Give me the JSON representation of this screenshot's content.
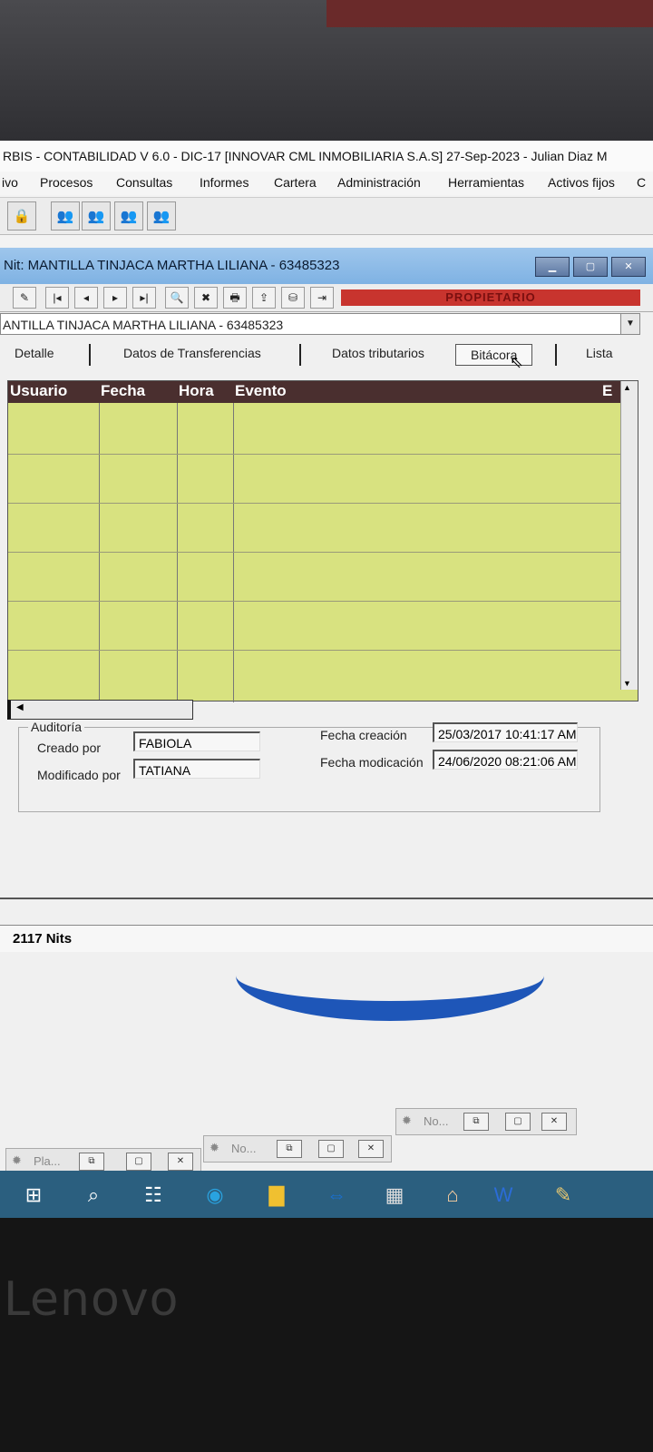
{
  "app": {
    "title": "RBIS - CONTABILIDAD V 6.0 - DIC-17 [INNOVAR CML INMOBILIARIA S.A.S] 27-Sep-2023 - Julian Diaz M",
    "menu": [
      "ivo",
      "Procesos",
      "Consultas",
      "Informes",
      "Cartera",
      "Administración",
      "Herramientas",
      "Activos fijos",
      "C"
    ]
  },
  "window": {
    "title": "Nit: MANTILLA TINJACA MARTHA LILIANA - 63485323",
    "role_badge": "PROPIETARIO",
    "selector_value": "ANTILLA TINJACA MARTHA LILIANA - 63485323",
    "tabs": [
      "Detalle",
      "Datos de Transferencias",
      "Datos tributarios",
      "Bitácora",
      "Lista"
    ],
    "active_tab": "Bitácora"
  },
  "grid": {
    "columns": [
      "Usuario",
      "Fecha",
      "Hora",
      "Evento",
      "E"
    ],
    "rows": [],
    "background": "#d8e280"
  },
  "auditoria": {
    "legend": "Auditoría",
    "creado_por_label": "Creado por",
    "creado_por": "FABIOLA",
    "modificado_por_label": "Modificado por",
    "modificado_por": "TATIANA",
    "fecha_creacion_label": "Fecha creación",
    "fecha_creacion": "25/03/2017 10:41:17 AM",
    "fecha_modificacion_label": "Fecha modicación",
    "fecha_modificacion": "24/06/2020 08:21:06 AM"
  },
  "status": {
    "count": "2117 Nits"
  },
  "minimized": [
    "Pla...",
    "No...",
    "No..."
  ],
  "taskbar_icons": [
    "windows-icon",
    "search-icon",
    "task-view-icon",
    "edge-icon",
    "file-explorer-icon",
    "teamviewer-icon",
    "calculator-icon",
    "home-icon",
    "word-icon",
    "paint-icon"
  ],
  "brand": "Lenovo"
}
